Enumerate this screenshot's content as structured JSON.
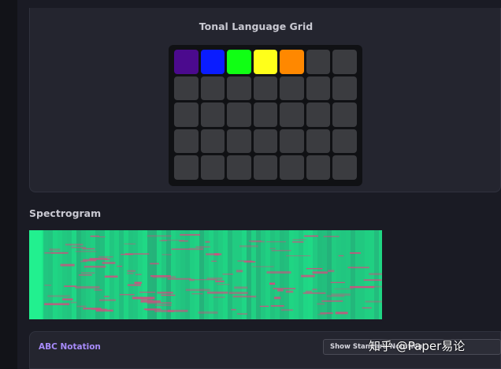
{
  "tonal_grid": {
    "title": "Tonal Language Grid",
    "cells": [
      "#4b0a8e",
      "#0a1cff",
      "#10ff14",
      "#ffff1a",
      "#ff8800",
      "#3b3c40",
      "#3b3c40",
      "#3b3c40",
      "#3b3c40",
      "#3b3c40",
      "#3b3c40",
      "#3b3c40",
      "#3b3c40",
      "#3b3c40",
      "#3b3c40",
      "#3b3c40",
      "#3b3c40",
      "#3b3c40",
      "#3b3c40",
      "#3b3c40",
      "#3b3c40",
      "#3b3c40",
      "#3b3c40",
      "#3b3c40",
      "#3b3c40",
      "#3b3c40",
      "#3b3c40",
      "#3b3c40",
      "#3b3c40",
      "#3b3c40",
      "#3b3c40",
      "#3b3c40",
      "#3b3c40",
      "#3b3c40",
      "#3b3c40"
    ]
  },
  "spectrogram": {
    "title": "Spectrogram",
    "base_color": "#1de88a",
    "highlight_color": "#e0457f"
  },
  "abc": {
    "title": "ABC Notation",
    "button_label": "Show Standard Notation"
  },
  "watermark": {
    "text": "知乎 @Paper易论"
  }
}
